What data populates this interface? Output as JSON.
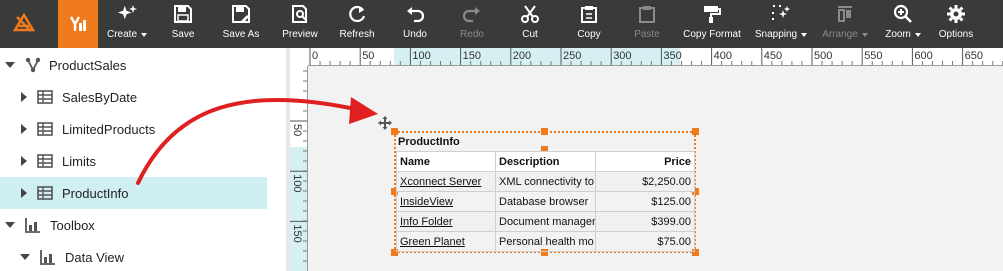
{
  "toolbar": {
    "items": [
      {
        "label": "Create",
        "icon": "create-icon",
        "dropdown": true
      },
      {
        "label": "Save",
        "icon": "save-icon"
      },
      {
        "label": "Save As",
        "icon": "save-as-icon"
      },
      {
        "label": "Preview",
        "icon": "preview-icon"
      },
      {
        "label": "Refresh",
        "icon": "refresh-icon"
      },
      {
        "label": "Undo",
        "icon": "undo-icon"
      },
      {
        "label": "Redo",
        "icon": "redo-icon",
        "disabled": true
      },
      {
        "label": "Cut",
        "icon": "cut-icon"
      },
      {
        "label": "Copy",
        "icon": "copy-icon"
      },
      {
        "label": "Paste",
        "icon": "paste-icon",
        "disabled": true
      },
      {
        "label": "Copy Format",
        "icon": "format-painter-icon"
      },
      {
        "label": "Snapping",
        "icon": "snapping-icon",
        "dropdown": true
      },
      {
        "label": "Arrange",
        "icon": "arrange-icon",
        "dropdown": true,
        "disabled": true
      },
      {
        "label": "Zoom",
        "icon": "zoom-icon",
        "dropdown": true
      },
      {
        "label": "Options",
        "icon": "gear-icon"
      }
    ]
  },
  "tree": {
    "items": [
      {
        "label": "ProductSales",
        "level": 0,
        "expanded": true,
        "icon": "hierarchy-icon"
      },
      {
        "label": "SalesByDate",
        "level": 1,
        "expanded": false,
        "icon": "table-icon"
      },
      {
        "label": "LimitedProducts",
        "level": 1,
        "expanded": false,
        "icon": "table-icon"
      },
      {
        "label": "Limits",
        "level": 1,
        "expanded": false,
        "icon": "table-icon"
      },
      {
        "label": "ProductInfo",
        "level": 1,
        "expanded": false,
        "icon": "table-icon",
        "selected": true
      },
      {
        "label": "Toolbox",
        "level": 0,
        "expanded": true,
        "icon": "chart-icon"
      },
      {
        "label": "Data View",
        "level": 1,
        "expanded": true,
        "icon": "chart-icon"
      }
    ]
  },
  "ruler": {
    "top_labels": [
      "0",
      "50",
      "100",
      "150",
      "200",
      "250",
      "300",
      "350",
      "400",
      "450",
      "500",
      "550",
      "600",
      "650"
    ],
    "left_labels": [
      "50",
      "100",
      "150"
    ]
  },
  "report": {
    "title": "ProductInfo",
    "columns": [
      "Name",
      "Description",
      "Price"
    ],
    "rows": [
      {
        "name": "Xconnect Server",
        "description": "XML connectivity to",
        "price": "$2,250.00"
      },
      {
        "name": "InsideView",
        "description": "Database browser",
        "price": "$125.00"
      },
      {
        "name": "Info Folder",
        "description": "Document manager",
        "price": "$399.00"
      },
      {
        "name": "Green Planet",
        "description": "Personal health mo",
        "price": "$75.00"
      }
    ]
  },
  "colors": {
    "toolbar_bg": "#3a3a3a",
    "accent": "#f07b1d",
    "selected_row": "#cfeff3",
    "annotation_arrow": "#e02020",
    "ruler_highlight": "#d6eff2"
  }
}
